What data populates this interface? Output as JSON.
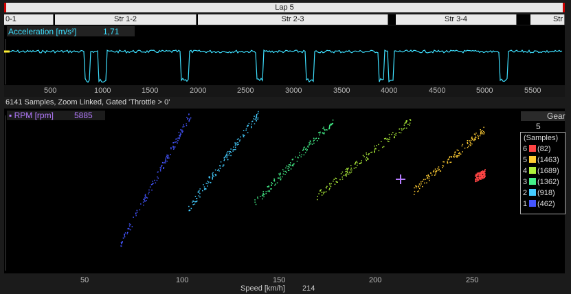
{
  "lap_label": "Lap 5",
  "segments": [
    {
      "label": "0-1"
    },
    {
      "label": "Str 1-2"
    },
    {
      "label": "Str 2-3"
    },
    {
      "label": "Str 3-4"
    },
    {
      "label": "Str"
    }
  ],
  "accel": {
    "label": "Acceleration [m/s²]",
    "value": "1,71",
    "color": "#3ee0ff",
    "x_ticks": [
      "500",
      "1000",
      "1500",
      "2000",
      "2500",
      "3000",
      "3500",
      "4000",
      "4500",
      "5000",
      "5500"
    ]
  },
  "scatter": {
    "info": "6141 Samples, Zoom Linked, Gated 'Throttle > 0'",
    "rpm_label": "RPM [rpm]",
    "rpm_value": "5885",
    "gear_title": "Gear",
    "gear_current": "5",
    "legend_header": "(Samples)",
    "x_label": "Speed [km/h]",
    "x_value": "214",
    "x_ticks": [
      "50",
      "100",
      "150",
      "200",
      "250"
    ]
  },
  "chart_data": {
    "type": "scatter",
    "xlabel": "Speed [km/h]",
    "ylabel": "RPM [rpm]",
    "xlim": [
      10,
      290
    ],
    "series": [
      {
        "name": "6",
        "samples": "(82)",
        "color": "#ff4444",
        "x_range": [
          245,
          250
        ],
        "y_range": [
          0.58,
          0.61
        ]
      },
      {
        "name": "5",
        "samples": "(1463)",
        "color": "#ffcc33",
        "x_range": [
          214,
          250
        ],
        "y_range": [
          0.5,
          0.88
        ]
      },
      {
        "name": "4",
        "samples": "(1689)",
        "color": "#aef03a",
        "x_range": [
          166,
          213
        ],
        "y_range": [
          0.47,
          0.93
        ]
      },
      {
        "name": "3",
        "samples": "(1362)",
        "color": "#44ee88",
        "x_range": [
          135,
          174
        ],
        "y_range": [
          0.43,
          0.93
        ]
      },
      {
        "name": "2",
        "samples": "(918)",
        "color": "#44ccff",
        "x_range": [
          102,
          137
        ],
        "y_range": [
          0.4,
          0.97
        ]
      },
      {
        "name": "1",
        "samples": "(462)",
        "color": "#4455ff",
        "x_range": [
          68,
          103
        ],
        "y_range": [
          0.18,
          0.97
        ]
      }
    ]
  }
}
